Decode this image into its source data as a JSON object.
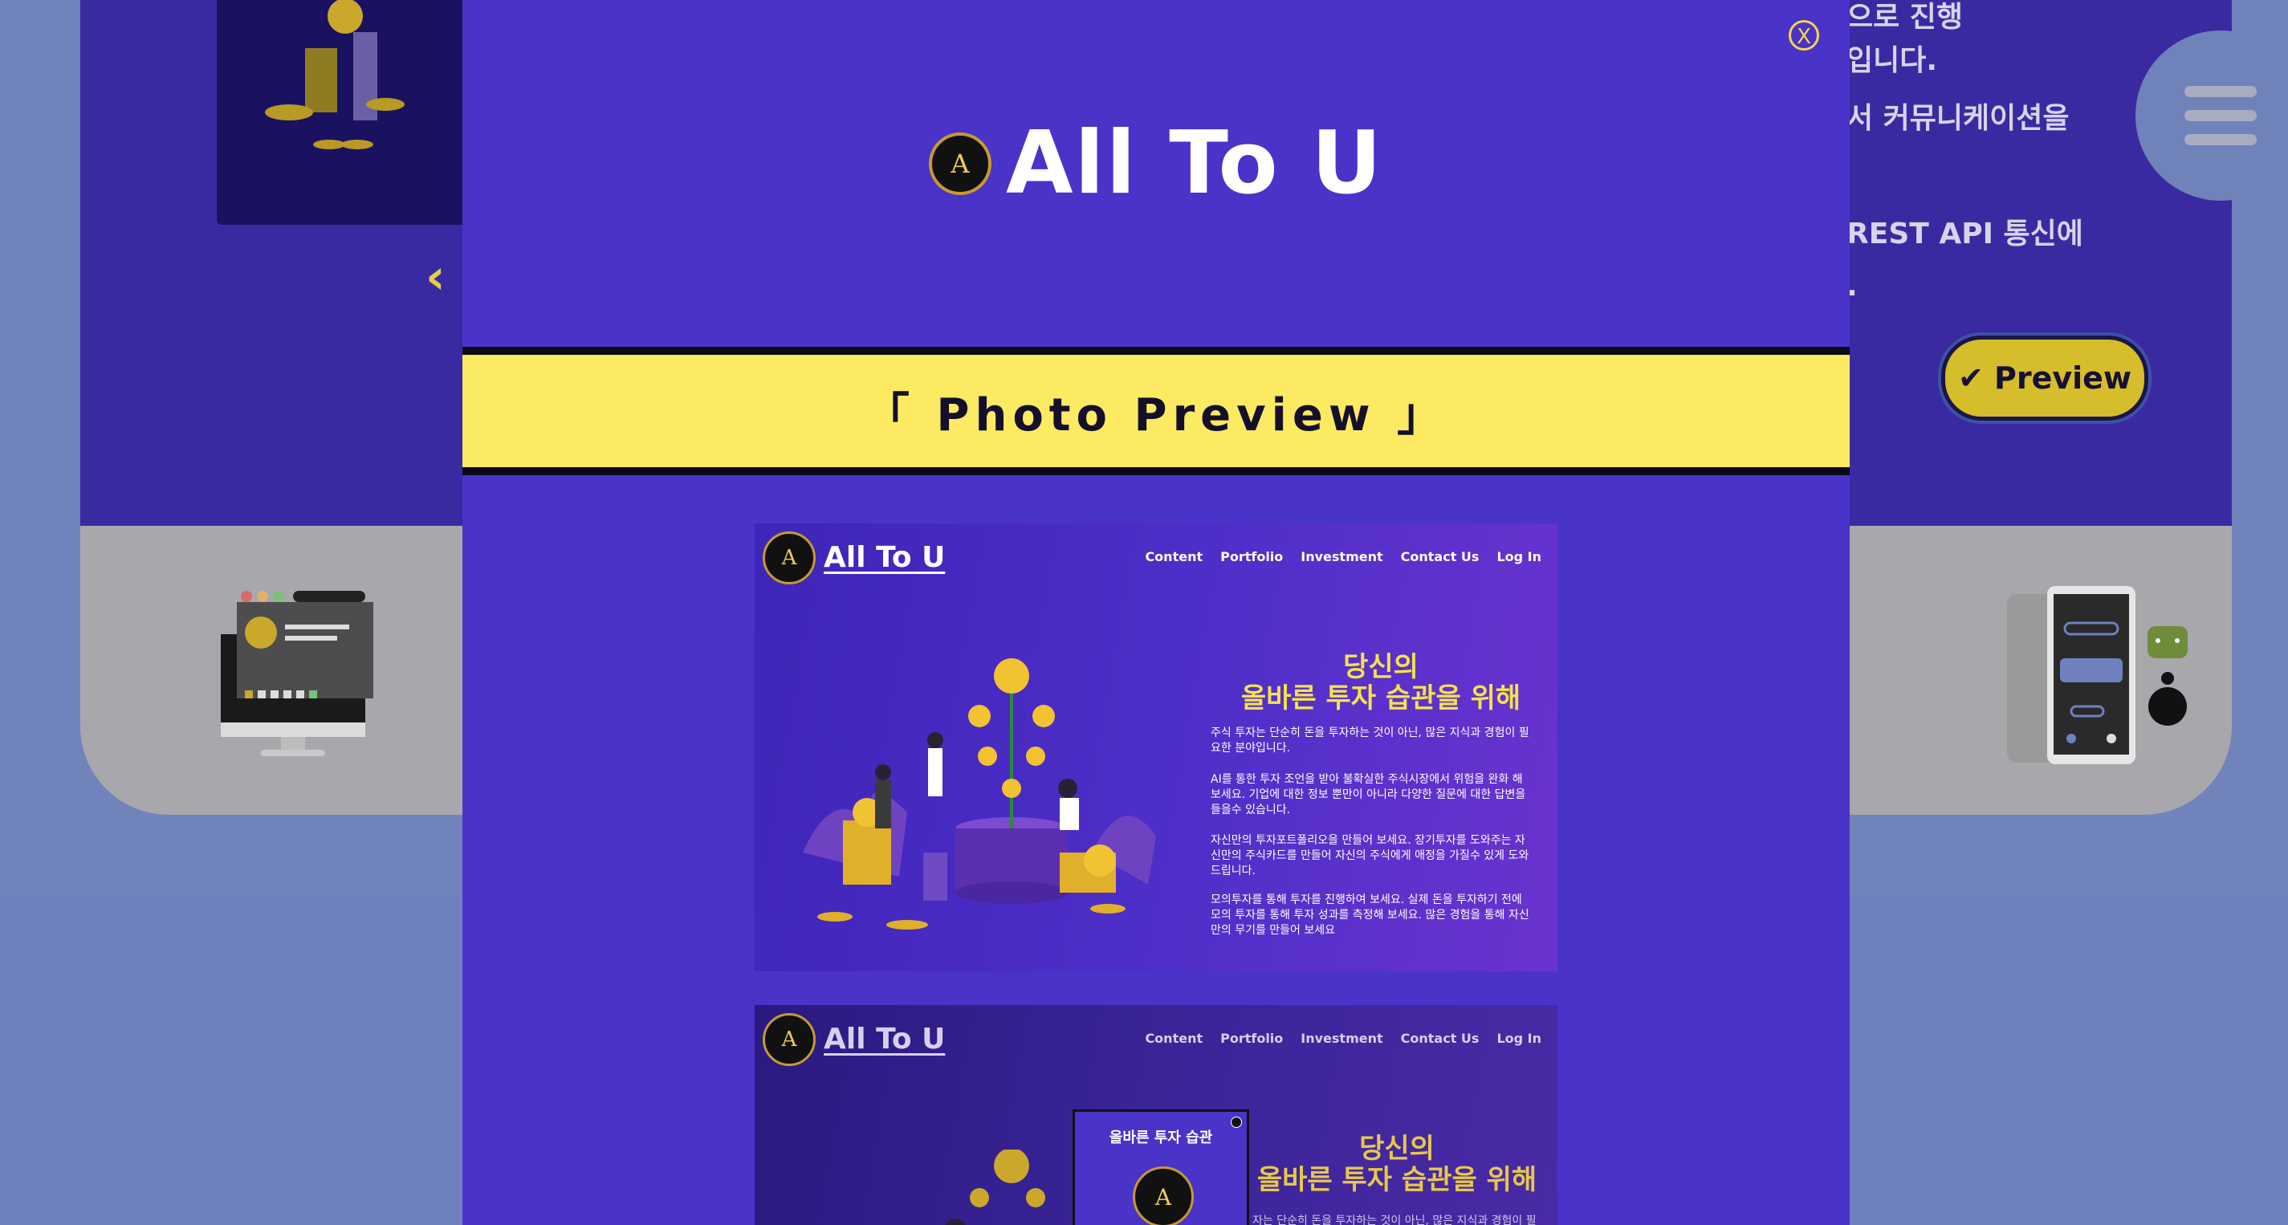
{
  "background": {
    "text_lines": [
      "으로 진행",
      "입니다.",
      "서 커뮤니케이션을",
      "REST API 통신에",
      "."
    ],
    "preview_button": "✔ Preview",
    "prev_arrow": "‹"
  },
  "modal": {
    "close_label": "X",
    "brand": {
      "logo_letter": "A",
      "name": "All To U"
    },
    "section_title": "「 Photo Preview 」"
  },
  "screenshot1": {
    "logo_letter": "A",
    "brand": "All To U",
    "nav": [
      "Content",
      "Portfolio",
      "Investment",
      "Contact Us",
      "Log In"
    ],
    "headline_line1": "당신의",
    "headline_line2": "올바른 투자 습관을 위해",
    "paragraphs": [
      "주식 투자는 단순히 돈을 투자하는 것이 아닌, 많은 지식과 경험이 필요한 분야입니다.",
      "AI를 통한 투자 조언을 받아 불확실한 주식시장에서 위험을 완화 해보세요. 기업에 대한 정보 뿐만이 아니라 다양한 질문에 대한 답변을 들을수 있습니다.",
      "자신만의 투자포트폴리오을 만들어 보세요. 장기투자를 도와주는 자신만의 주식카드를 만들어 자신의 주식에게 애정을 가질수 있게 도와드립니다.",
      "모의투자를 통해 투자를 진행하여 보세요. 실제 돈을 투자하기 전에 모의 투자를 통해 투자 성과를 측정해 보세요. 많은 경험을 통해 자신만의 무기를 만들어 보세요"
    ]
  },
  "screenshot2": {
    "logo_letter": "A",
    "brand": "All To U",
    "nav": [
      "Content",
      "Portfolio",
      "Investment",
      "Contact Us",
      "Log In"
    ],
    "popup_title": "올바른 투자 습관",
    "popup_logo_letter": "A",
    "headline_line1": "당신의",
    "headline_line2": "올바른 투자 습관을 위해",
    "paragraph_fragment": "자는 단순히 돈을 투자하는 것이 아닌, 많은 지식과 경험이 필"
  },
  "colors": {
    "modal_bg": "#4a33c8",
    "banner_bg": "#fdea63",
    "accent_gold": "#f4d64a",
    "headline_yellow": "#f4e24b"
  }
}
